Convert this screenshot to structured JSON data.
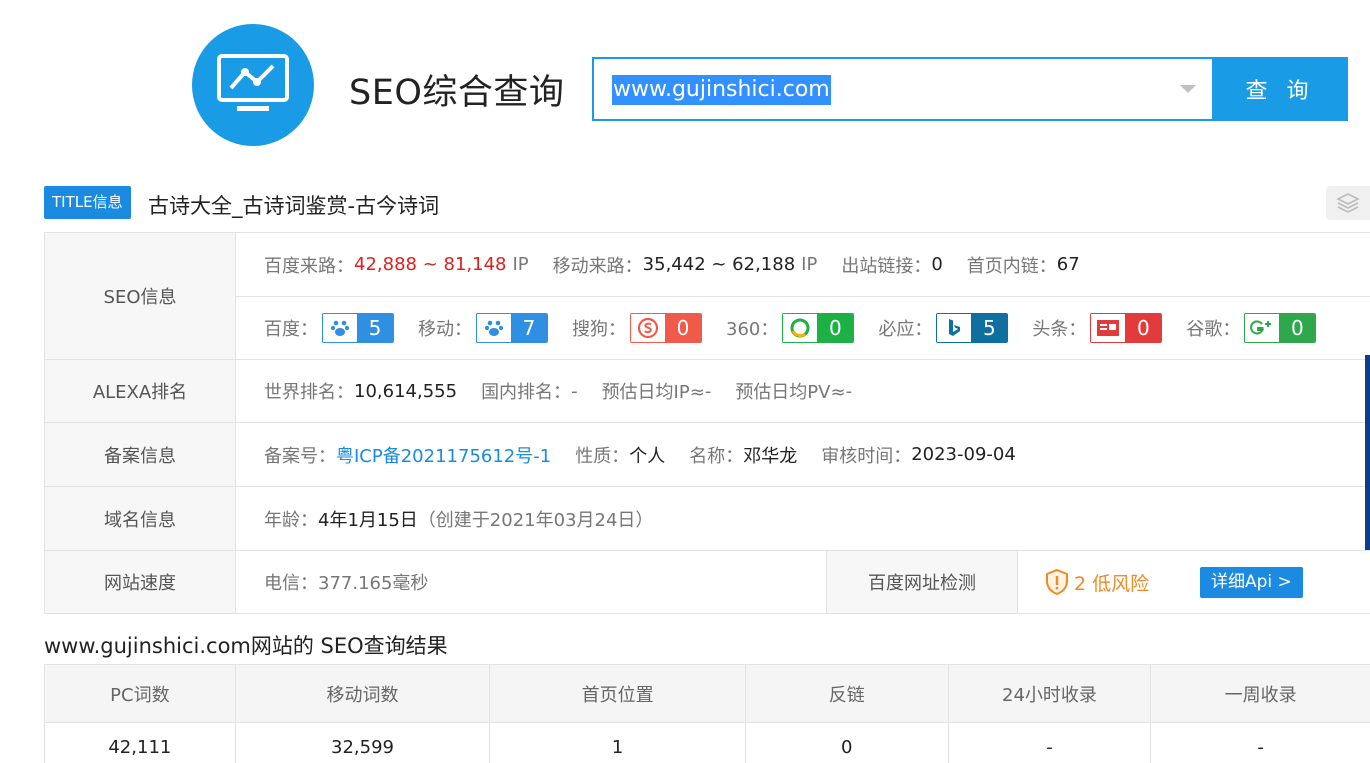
{
  "header": {
    "app_title": "SEO综合查询",
    "search_value": "www.gujinshici.com",
    "search_button": "查 询"
  },
  "title_info": {
    "badge": "TITLE信息",
    "text": "古诗大全_古诗词鉴赏-古今诗词"
  },
  "seo": {
    "label": "SEO信息",
    "baidu_traffic_label": "百度来路：",
    "baidu_traffic_value": "42,888 ~ 81,148",
    "baidu_traffic_unit": "IP",
    "mobile_traffic_label": "移动来路：",
    "mobile_traffic_value": "35,442 ~ 62,188",
    "mobile_traffic_unit": "IP",
    "outbound_label": "出站链接：",
    "outbound_value": "0",
    "internal_label": "首页内链：",
    "internal_value": "67",
    "engines": [
      {
        "label": "百度：",
        "value": "5",
        "icon": "baidu-paw-icon",
        "color": "#2f8fe0"
      },
      {
        "label": "移动：",
        "value": "7",
        "icon": "baidu-mobile-paw-icon",
        "color": "#2f8fe0"
      },
      {
        "label": "搜狗：",
        "value": "0",
        "icon": "sogou-icon",
        "color": "#ef5a4a"
      },
      {
        "label": "360：",
        "value": "0",
        "icon": "360-icon",
        "color": "#1db045"
      },
      {
        "label": "必应：",
        "value": "5",
        "icon": "bing-icon",
        "color": "#0f70a0"
      },
      {
        "label": "头条：",
        "value": "0",
        "icon": "toutiao-icon",
        "color": "#e33b3b"
      },
      {
        "label": "谷歌：",
        "value": "0",
        "icon": "google-plus-icon",
        "color": "#2ea84b"
      }
    ]
  },
  "alexa": {
    "label": "ALEXA排名",
    "world_label": "世界排名：",
    "world_value": "10,614,555",
    "domestic_label": "国内排名：",
    "domestic_value": "-",
    "daily_ip_label": "预估日均IP≈",
    "daily_ip_value": "-",
    "daily_pv_label": "预估日均PV≈",
    "daily_pv_value": "-"
  },
  "icp": {
    "label": "备案信息",
    "number_label": "备案号：",
    "number_value": "粤ICP备2021175612号-1",
    "nature_label": "性质：",
    "nature_value": "个人",
    "name_label": "名称：",
    "name_value": "邓华龙",
    "audit_label": "审核时间：",
    "audit_value": "2023-09-04"
  },
  "domain": {
    "label": "域名信息",
    "age_label": "年龄：",
    "age_value": "4年1月15日",
    "created": "（创建于2021年03月24日）"
  },
  "speed": {
    "label": "网站速度",
    "telecom_label": "电信：",
    "telecom_value": "377.165毫秒",
    "baidu_check_label": "百度网址检测",
    "risk_text": "2 低风险",
    "api_button": "详细Api >"
  },
  "results": {
    "title": "www.gujinshici.com网站的 SEO查询结果",
    "headers": [
      "PC词数",
      "移动词数",
      "首页位置",
      "反链",
      "24小时收录",
      "一周收录"
    ],
    "values": [
      "42,111",
      "32,599",
      "1",
      "0",
      "-",
      "-"
    ]
  },
  "colors": {
    "accent": "#1a9be6",
    "red": "#e02020",
    "risk": "#f08a24"
  }
}
